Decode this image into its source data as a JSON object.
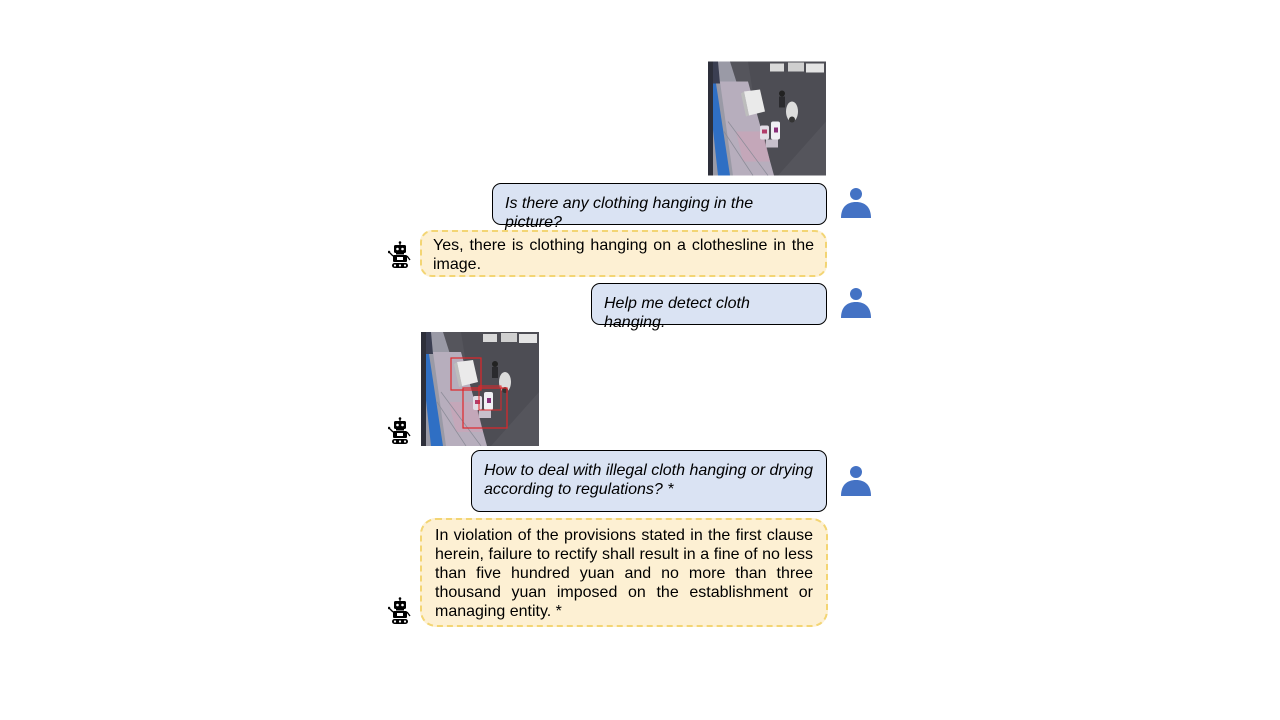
{
  "conversation": {
    "user_message_1": "Is there any clothing hanging in the picture?",
    "bot_message_1": "Yes, there is clothing hanging on a clothesline in the image.",
    "user_message_2": "Help me detect cloth hanging.",
    "user_message_3": "How to deal with illegal cloth hanging or drying according to regulations? *",
    "bot_message_3": "In violation of the provisions stated in the first clause herein, failure to rectify shall result in a fine of no less than five hundred yuan and no more than three thousand yuan imposed on the establishment or managing entity.  *"
  },
  "colors": {
    "user_bubble_fill": "#dae3f3",
    "bot_bubble_fill": "#fdf0d3",
    "bot_bubble_border": "#f3d574",
    "user_icon": "#4472c4",
    "detection_box": "#e0262a"
  },
  "icons": {
    "user": "person-icon",
    "bot": "robot-icon"
  }
}
